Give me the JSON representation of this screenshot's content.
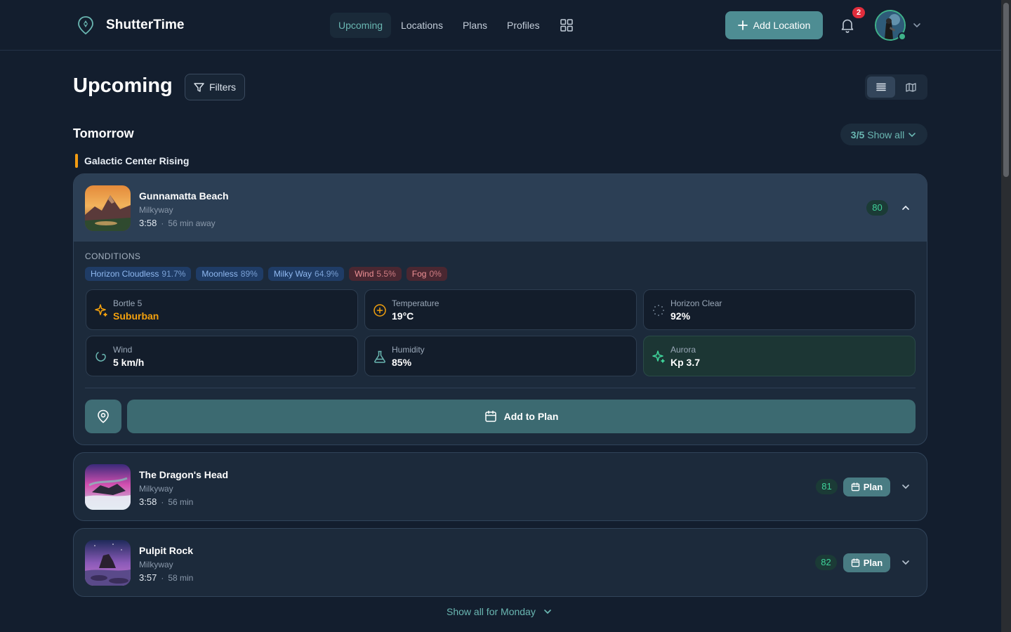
{
  "app": {
    "name": "ShutterTime"
  },
  "nav": {
    "items": [
      {
        "label": "Upcoming",
        "active": true
      },
      {
        "label": "Locations",
        "active": false
      },
      {
        "label": "Plans",
        "active": false
      },
      {
        "label": "Profiles",
        "active": false
      }
    ],
    "grid_icon": "grid-icon"
  },
  "header": {
    "add_location_label": "Add Location",
    "notification_count": "2"
  },
  "page": {
    "title": "Upcoming",
    "filters_label": "Filters",
    "view_modes": [
      "list-icon",
      "map-icon"
    ]
  },
  "section": {
    "title": "Tomorrow",
    "show_all_count": "3/5",
    "show_all_label": "Show all",
    "event_name": "Galactic Center Rising",
    "footer_label": "Show all for Monday"
  },
  "colors": {
    "accent": "#6ab7b2",
    "primary_button": "#4e8d93",
    "event_bar": "#f39c12",
    "score_green": "#3fd39a",
    "badge_red": "#e02d3c"
  },
  "locations": [
    {
      "name": "Gunnamatta Beach",
      "type": "Milkyway",
      "time": "3:58",
      "distance": "56 min away",
      "score": "80",
      "expanded": true,
      "conditions_label": "CONDITIONS",
      "tags": [
        {
          "label": "Horizon Cloudless",
          "value": "91.7%",
          "tone": "blue"
        },
        {
          "label": "Moonless",
          "value": "89%",
          "tone": "blue"
        },
        {
          "label": "Milky Way",
          "value": "64.9%",
          "tone": "blue"
        },
        {
          "label": "Wind",
          "value": "5.5%",
          "tone": "red"
        },
        {
          "label": "Fog",
          "value": "0%",
          "tone": "red"
        }
      ],
      "metrics": [
        {
          "label": "Bortle 5",
          "value": "Suburban",
          "icon": "sparkle-icon"
        },
        {
          "label": "Temperature",
          "value": "19°C",
          "icon": "sun-icon"
        },
        {
          "label": "Horizon Clear",
          "value": "92%",
          "icon": "loader-icon"
        },
        {
          "label": "Wind",
          "value": "5 km/h",
          "icon": "wind-icon"
        },
        {
          "label": "Humidity",
          "value": "85%",
          "icon": "flask-icon"
        },
        {
          "label": "Aurora",
          "value": "Kp 3.7",
          "icon": "sparkle-icon"
        }
      ],
      "add_to_plan_label": "Add to Plan"
    },
    {
      "name": "The Dragon's Head",
      "type": "Milkyway",
      "time": "3:58",
      "distance": "56 min",
      "score": "81",
      "expanded": false,
      "plan_label": "Plan"
    },
    {
      "name": "Pulpit Rock",
      "type": "Milkyway",
      "time": "3:57",
      "distance": "58 min",
      "score": "82",
      "expanded": false,
      "plan_label": "Plan"
    }
  ]
}
